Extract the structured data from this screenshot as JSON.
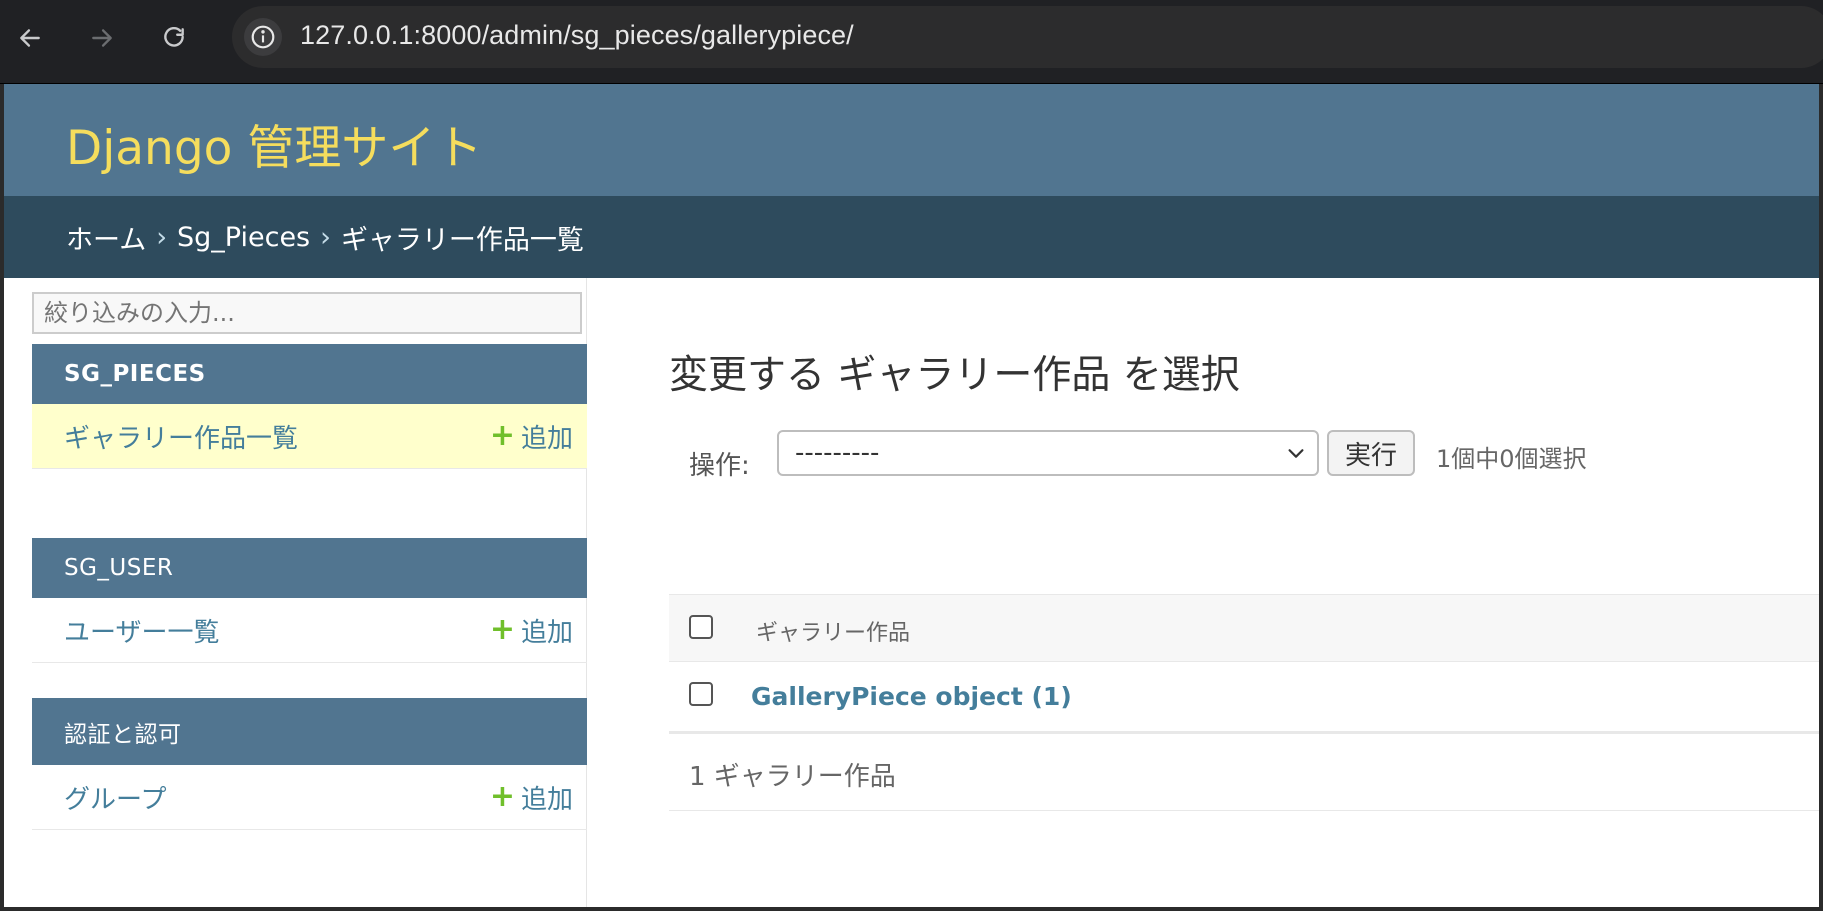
{
  "browser": {
    "url": "127.0.0.1:8000/admin/sg_pieces/gallerypiece/"
  },
  "header": {
    "site_title": "Django 管理サイト"
  },
  "breadcrumbs": {
    "home": "ホーム",
    "app": "Sg_Pieces",
    "current": "ギャラリー作品一覧",
    "separator": "›"
  },
  "sidebar": {
    "filter_placeholder": "絞り込みの入力...",
    "add_label": "追加",
    "apps": [
      {
        "name": "SG_PIECES",
        "model": "ギャラリー作品一覧",
        "current": true
      },
      {
        "name": "SG_USER",
        "model": "ユーザー一覧",
        "current": false
      },
      {
        "name": "認証と認可",
        "model": "グループ",
        "current": false
      }
    ]
  },
  "main": {
    "title": "変更する ギャラリー作品 を選択",
    "actions": {
      "label": "操作:",
      "selected_option": "---------",
      "run_label": "実行",
      "selection_count": "1個中0個選択"
    },
    "table": {
      "column_header": "ギャラリー作品",
      "rows": [
        {
          "label": "GalleryPiece object (1)",
          "checked": false
        }
      ]
    },
    "paginator": "1 ギャラリー作品"
  },
  "colors": {
    "header_bg": "#517590",
    "breadcrumb_bg": "#2e4b5d",
    "brand_yellow": "#f5dd5d",
    "link": "#447e9b",
    "add_green": "#70bf2b",
    "current_row": "#ffffcc"
  }
}
